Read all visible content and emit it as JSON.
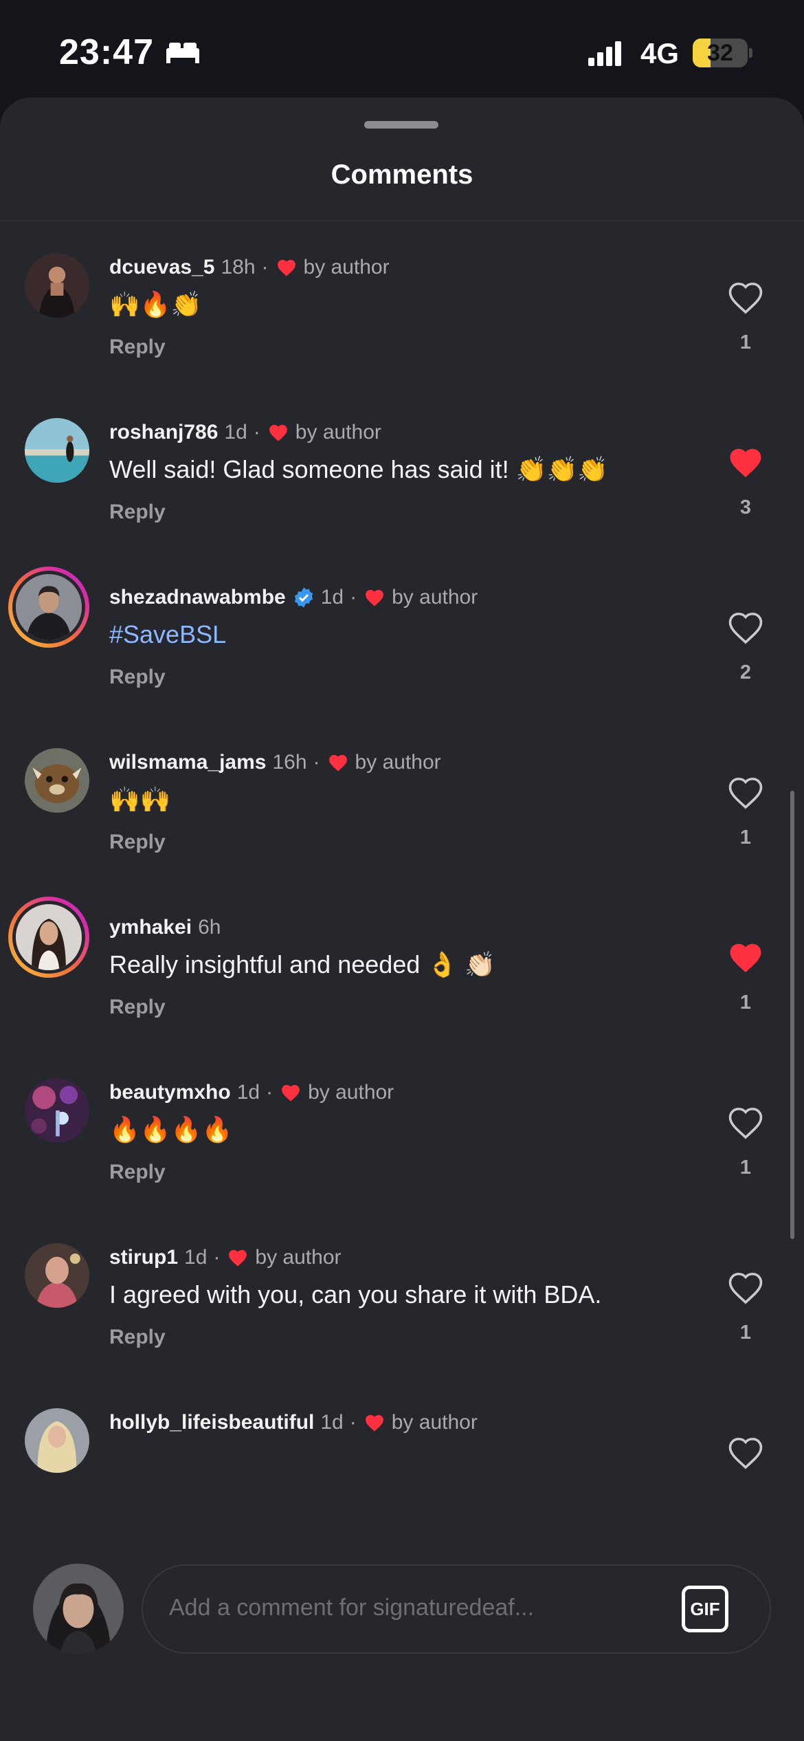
{
  "status_bar": {
    "time": "23:47",
    "network": "4G",
    "battery_level": "32",
    "battery_fraction": 0.32,
    "icons": [
      "bed-icon",
      "signal-icon",
      "battery-icon"
    ]
  },
  "sheet": {
    "title": "Comments"
  },
  "comments": [
    {
      "username": "dcuevas_5",
      "time": "18h",
      "sep": "·",
      "author_badge": "by author",
      "liked_by_author": true,
      "text": "🙌🔥👏",
      "reply_label": "Reply",
      "likes": "1",
      "liked": false,
      "verified": false,
      "story_ring": false
    },
    {
      "username": "roshanj786",
      "time": "1d",
      "sep": "·",
      "author_badge": "by author",
      "liked_by_author": true,
      "text": "Well said! Glad someone has said it! 👏👏👏",
      "reply_label": "Reply",
      "likes": "3",
      "liked": true,
      "verified": false,
      "story_ring": false
    },
    {
      "username": "shezadnawabmbe",
      "time": "1d",
      "sep": "·",
      "author_badge": "by author",
      "liked_by_author": true,
      "text": "#SaveBSL",
      "reply_label": "Reply",
      "likes": "2",
      "liked": false,
      "verified": true,
      "story_ring": true
    },
    {
      "username": "wilsmama_jams",
      "time": "16h",
      "sep": "·",
      "author_badge": "by author",
      "liked_by_author": true,
      "text": "🙌🙌",
      "reply_label": "Reply",
      "likes": "1",
      "liked": false,
      "verified": false,
      "story_ring": false
    },
    {
      "username": "ymhakei",
      "time": "6h",
      "sep": "",
      "author_badge": "",
      "liked_by_author": false,
      "text": "Really insightful and needed 👌 👏🏻",
      "reply_label": "Reply",
      "likes": "1",
      "liked": true,
      "verified": false,
      "story_ring": true
    },
    {
      "username": "beautymxho",
      "time": "1d",
      "sep": "·",
      "author_badge": "by author",
      "liked_by_author": true,
      "text": "🔥🔥🔥🔥",
      "reply_label": "Reply",
      "likes": "1",
      "liked": false,
      "verified": false,
      "story_ring": false
    },
    {
      "username": "stirup1",
      "time": "1d",
      "sep": "·",
      "author_badge": "by author",
      "liked_by_author": true,
      "text": "I agreed with you, can you share it with BDA.",
      "reply_label": "Reply",
      "likes": "1",
      "liked": false,
      "verified": false,
      "story_ring": false
    },
    {
      "username": "hollyb_lifeisbeautiful",
      "time": "1d",
      "sep": "·",
      "author_badge": "by author",
      "liked_by_author": true,
      "text": "",
      "reply_label": "",
      "likes": "",
      "liked": false,
      "verified": false,
      "story_ring": false
    }
  ],
  "emoji_bar": [
    "❤️",
    "🙌",
    "🔥",
    "👏",
    "😢",
    "😍",
    "😮",
    "😂"
  ],
  "compose": {
    "placeholder": "Add a comment for signaturedeaf...",
    "gif_label": "GIF"
  },
  "colors": {
    "background": "#25272d",
    "like_red": "#ff3040",
    "hashtag": "#8fb7ff",
    "verified_blue": "#3897f0"
  }
}
